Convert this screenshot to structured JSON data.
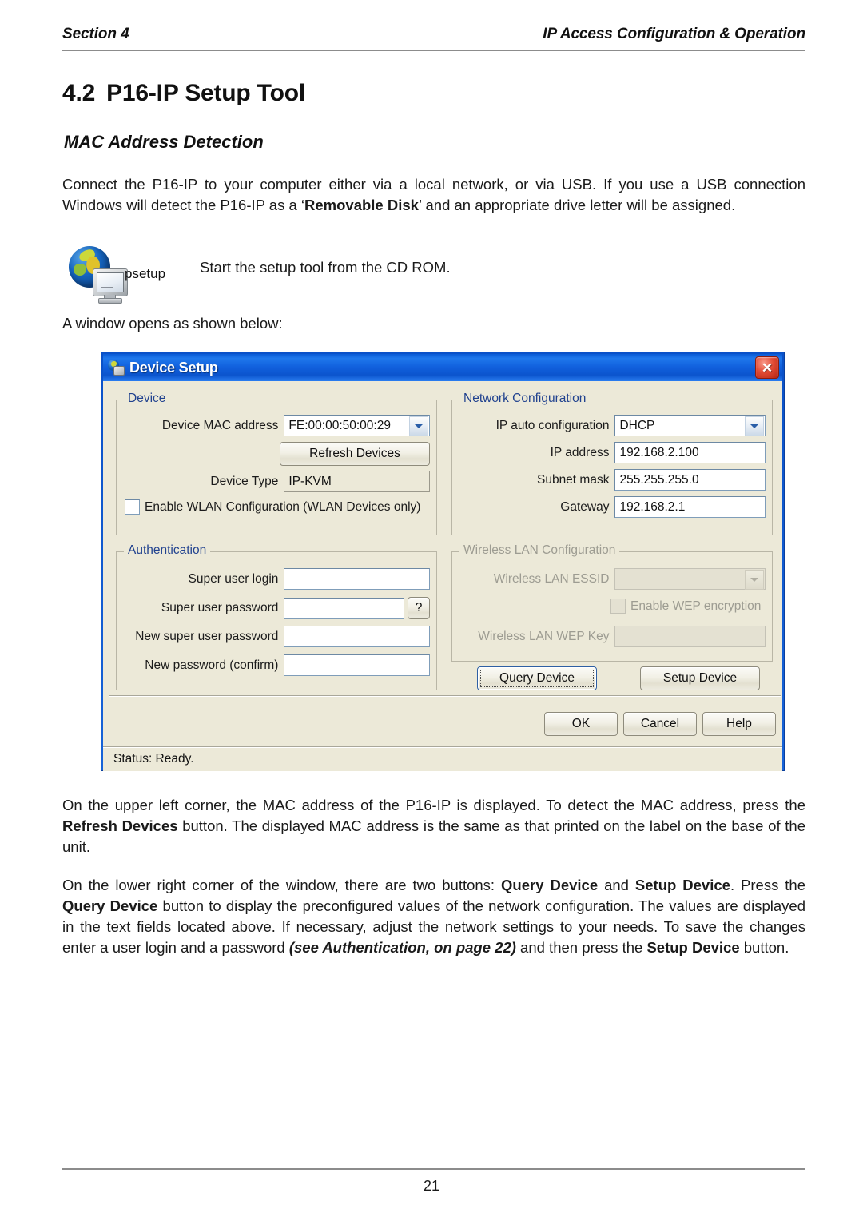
{
  "running_head": {
    "left": "Section 4",
    "right": "IP Access Configuration & Operation"
  },
  "headings": {
    "section_number": "4.2",
    "section_title": "P16-IP Setup Tool",
    "subheading": "MAC Address Detection"
  },
  "body": {
    "intro_1": "Connect the P16-IP to your computer either via a local network, or via USB. If you use a USB connection Windows will detect the P16-IP as a ‘",
    "intro_bold": "Removable Disk",
    "intro_2": "’ and an appropriate drive letter will be assigned.",
    "icon_caption": "psetup",
    "icon_sentence": "Start the setup tool from the CD ROM.",
    "window_opens": "A window opens as shown below:",
    "mac_1": "On the upper left corner, the MAC address of the P16-IP is displayed. To detect the MAC address, press the ",
    "mac_bold": "Refresh Devices",
    "mac_2": " button. The displayed MAC address is the same as that printed on the label on the base of the unit.",
    "buttons_1": "On the lower right corner of the window, there are two buttons: ",
    "buttons_b1": "Query Device",
    "buttons_2": " and ",
    "buttons_b2": "Setup Device",
    "buttons_3": ". Press the ",
    "buttons_b3": "Query Device",
    "buttons_4": " button to display the preconfigured values of the network configuration. The values are displayed in the text fields located above. If necessary, adjust the network settings to your needs. To save the changes enter a user login and a password ",
    "buttons_i1": "(see Authentication, on page 22)",
    "buttons_5": " and then press the ",
    "buttons_b4": "Setup Device",
    "buttons_6": " button."
  },
  "dialog": {
    "title": "Device Setup",
    "close_label": "✕",
    "device_group": {
      "legend": "Device",
      "mac_label": "Device MAC address",
      "mac_value": "FE:00:00:50:00:29",
      "refresh_button": "Refresh Devices",
      "type_label": "Device Type",
      "type_value": "IP-KVM",
      "wlan_checkbox": "Enable WLAN Configuration (WLAN Devices only)"
    },
    "network_group": {
      "legend": "Network Configuration",
      "auto_label": "IP auto configuration",
      "auto_value": "DHCP",
      "ip_label": "IP address",
      "ip_value": "192.168.2.100",
      "mask_label": "Subnet mask",
      "mask_value": "255.255.255.0",
      "gw_label": "Gateway",
      "gw_value": "192.168.2.1"
    },
    "auth_group": {
      "legend": "Authentication",
      "login_label": "Super user login",
      "login_value": "",
      "pw_label": "Super user password",
      "pw_value": "",
      "help_button": "?",
      "newpw_label": "New super user password",
      "newpw_value": "",
      "confirm_label": "New password (confirm)",
      "confirm_value": ""
    },
    "wlan_group": {
      "legend": "Wireless LAN Configuration",
      "essid_label": "Wireless LAN ESSID",
      "essid_value": "",
      "wep_checkbox": "Enable WEP encryption",
      "wepkey_label": "Wireless LAN WEP Key",
      "wepkey_value": ""
    },
    "action_buttons": {
      "query": "Query Device",
      "setup": "Setup Device",
      "ok": "OK",
      "cancel": "Cancel",
      "help": "Help"
    },
    "status": "Status: Ready."
  },
  "footer": {
    "page_number": "21"
  },
  "colors": {
    "titlebar_blue": "#1160dd",
    "dialog_face": "#ece9d8",
    "legend_blue": "#21428f",
    "close_red": "#e24b34",
    "disabled_grey": "#9d9c92"
  }
}
